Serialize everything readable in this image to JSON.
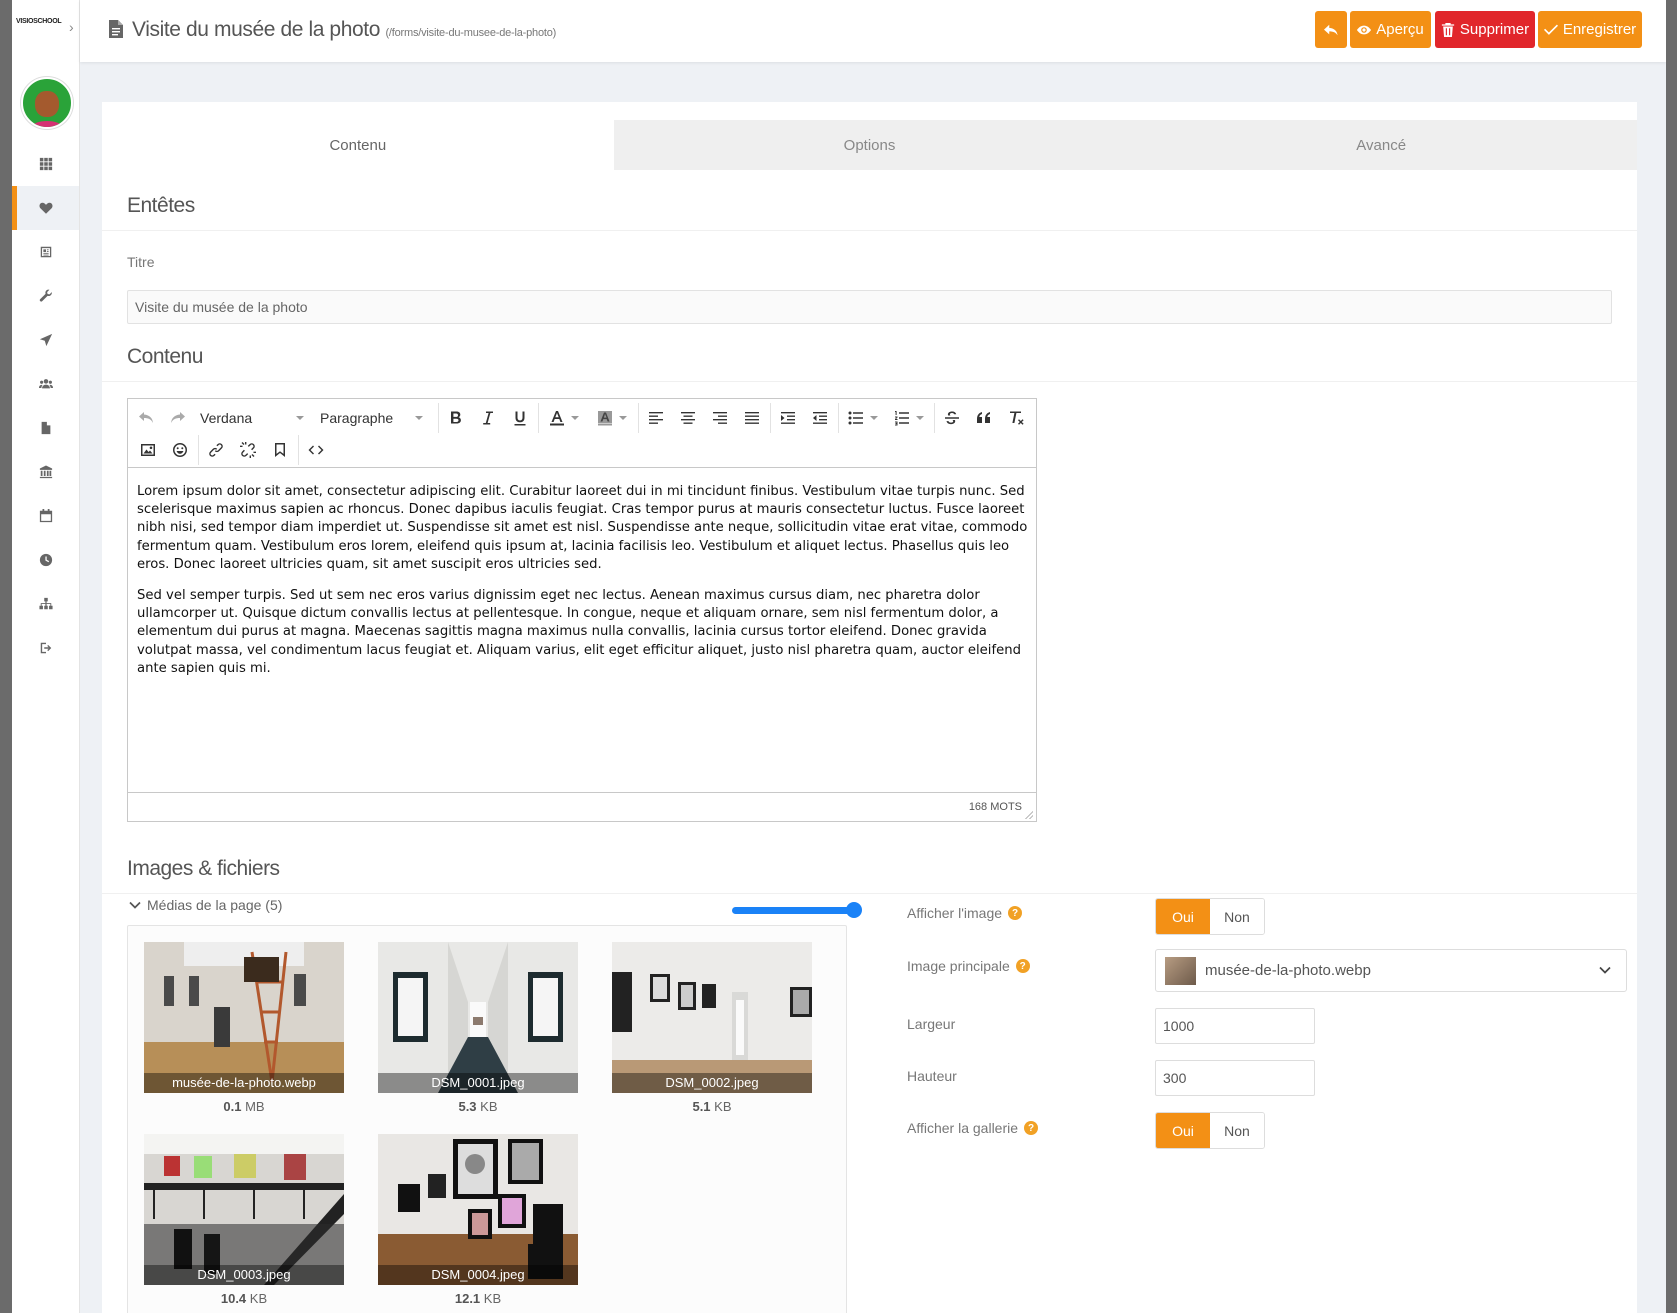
{
  "app": {
    "logo_text": "VISIOSCHOOL"
  },
  "header": {
    "title": "Visite du musée de la photo",
    "path": "(/forms/visite-du-musee-de-la-photo)",
    "buttons": {
      "preview": "Aperçu",
      "delete": "Supprimer",
      "save": "Enregistrer"
    }
  },
  "tabs": [
    {
      "label": "Contenu",
      "active": true
    },
    {
      "label": "Options",
      "active": false
    },
    {
      "label": "Avancé",
      "active": false
    }
  ],
  "headers_section": {
    "title": "Entêtes",
    "title_label": "Titre",
    "title_value": "Visite du musée de la photo"
  },
  "content_section": {
    "title": "Contenu",
    "toolbar": {
      "font": "Verdana",
      "block": "Paragraphe"
    },
    "paragraphs": [
      "Lorem ipsum dolor sit amet, consectetur adipiscing elit. Curabitur laoreet dui in mi tincidunt finibus. Vestibulum vitae turpis nunc. Sed scelerisque maximus sapien ac rhoncus. Donec dapibus iaculis feugiat. Cras tempor purus at mauris consectetur luctus. Fusce laoreet nibh nisi, sed tempor diam imperdiet ut. Suspendisse sit amet est nisl. Suspendisse ante neque, sollicitudin vitae erat vitae, commodo fermentum quam. Vestibulum eros lorem, eleifend quis ipsum at, lacinia facilisis leo. Vestibulum et aliquet lectus. Phasellus quis leo eros. Donec laoreet ultricies quam, sit amet suscipit eros ultricies sed.",
      "Sed vel semper turpis. Sed ut sem nec eros varius dignissim eget nec lectus. Aenean maximus cursus diam, nec pharetra dolor ullamcorper ut. Quisque dictum convallis lectus at pellentesque. In congue, neque et aliquam ornare, sem nisl fermentum dolor, a elementum dui purus at magna. Maecenas sagittis magna maximus nulla convallis, lacinia cursus tortor eleifend. Donec gravida volutpat massa, vel condimentum lacus feugiat et. Aliquam varius, elit eget efficitur aliquet, justo nisl pharetra quam, auctor eleifend ante sapien quis mi."
    ],
    "word_count": "168 MOTS"
  },
  "media_section": {
    "title": "Images & fichiers",
    "toggle_label": "Médias de la page (5)",
    "files": [
      {
        "name": "musée-de-la-photo.webp",
        "size": "0.1",
        "unit": "MB"
      },
      {
        "name": "DSM_0001.jpeg",
        "size": "5.3",
        "unit": "KB"
      },
      {
        "name": "DSM_0002.jpeg",
        "size": "5.1",
        "unit": "KB"
      },
      {
        "name": "DSM_0003.jpeg",
        "size": "10.4",
        "unit": "KB"
      },
      {
        "name": "DSM_0004.jpeg",
        "size": "12.1",
        "unit": "KB"
      }
    ]
  },
  "options": {
    "show_image": {
      "label": "Afficher l'image",
      "yes": "Oui",
      "no": "Non",
      "value": "Oui"
    },
    "main_image": {
      "label": "Image principale",
      "value": "musée-de-la-photo.webp"
    },
    "width": {
      "label": "Largeur",
      "value": "1000"
    },
    "height": {
      "label": "Hauteur",
      "value": "300"
    },
    "show_gallery": {
      "label": "Afficher la gallerie",
      "yes": "Oui",
      "no": "Non",
      "value": "Oui"
    }
  },
  "colors": {
    "accent": "#f39015",
    "danger": "#e1262b",
    "slider": "#1a82f7"
  }
}
